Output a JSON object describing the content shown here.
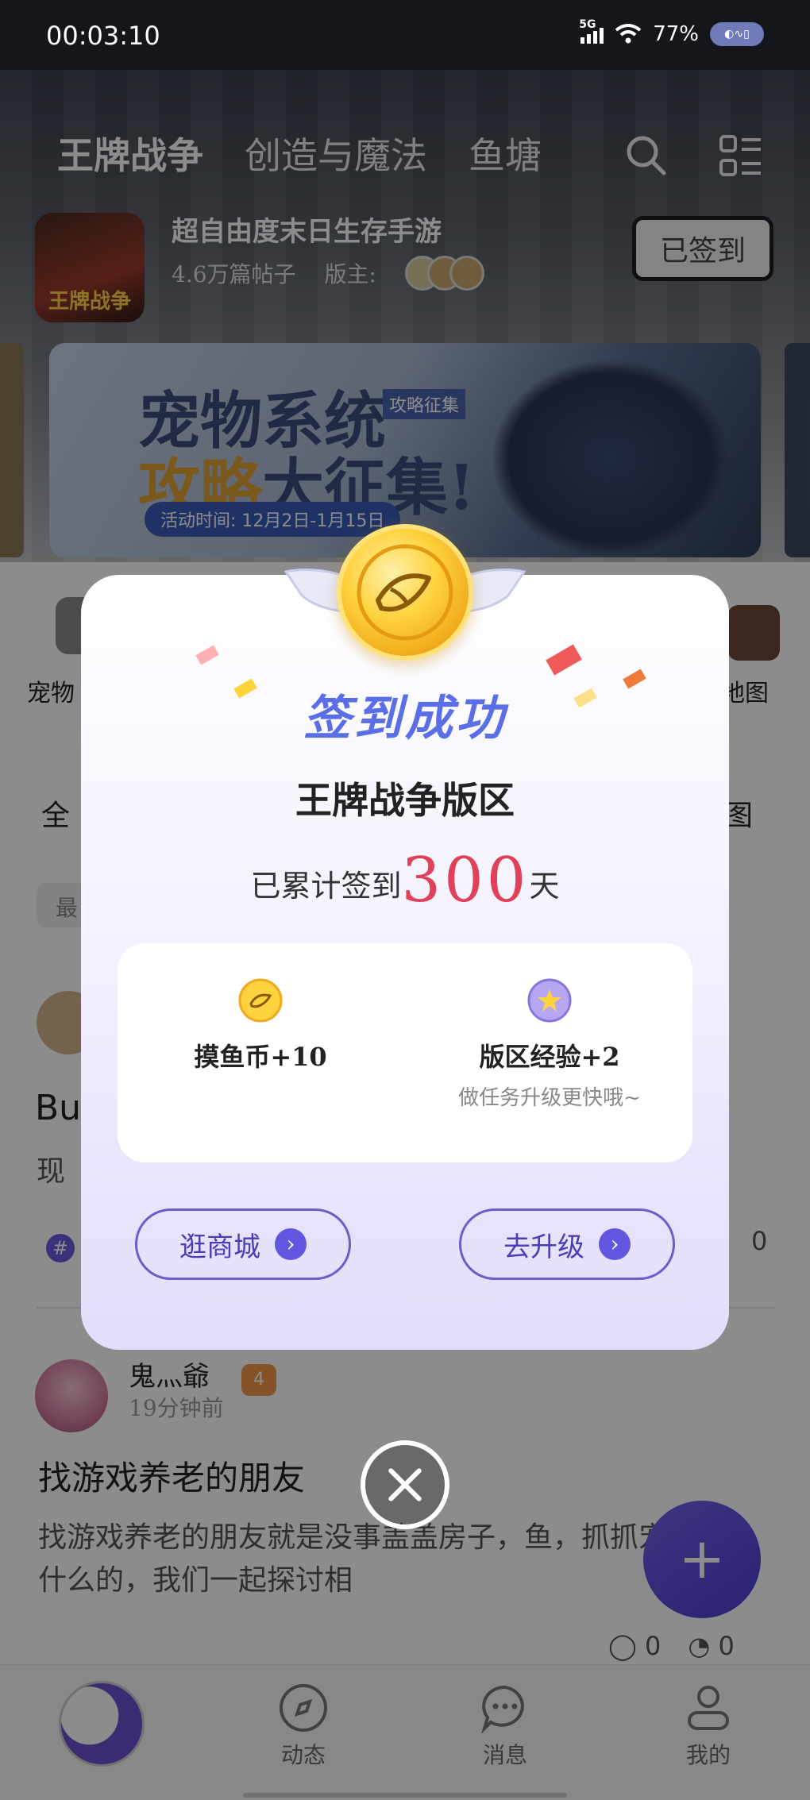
{
  "status_bar": {
    "time": "00:03:10",
    "network": "5G",
    "battery": "77%"
  },
  "header": {
    "tabs": [
      "王牌战争",
      "创造与魔法",
      "鱼塘"
    ],
    "active_tab": "王牌战争",
    "icons": [
      "search-icon",
      "menu-grid-icon"
    ]
  },
  "forum": {
    "name": "超自由度末日生存手游",
    "posts_count": "4.6万篇帖子",
    "moderators_label": "版主:",
    "signed_button": "已签到",
    "logo_text": "王牌战争"
  },
  "banner": {
    "line1": "宠物系统",
    "line2a": "攻略",
    "line2b": "大征集!",
    "tag": "攻略征集",
    "time": "活动时间: 12月2日-1月15日"
  },
  "quick_links": {
    "left": "宠物",
    "right": "地图"
  },
  "filter": {
    "left": "全",
    "right": "图",
    "chip": "最"
  },
  "post1": {
    "title": "Bu",
    "body": "现",
    "topic_icon": "#",
    "likes": "0"
  },
  "post2": {
    "author": "鬼灬爺",
    "level": "4",
    "time": "19分钟前",
    "title": "找游戏养老的朋友",
    "body": "找游戏养老的朋友就是没事盖盖房子，鱼，抓抓宠物什么的，我们一起探讨相",
    "comments": "0",
    "likes": "0"
  },
  "fab": {
    "label": "+"
  },
  "bottom_nav": {
    "items": [
      "动态",
      "消息",
      "我的"
    ]
  },
  "modal": {
    "title": "签到成功",
    "forum_title": "王牌战争版区",
    "streak_prefix": "已累计签到",
    "streak_days": "300",
    "streak_suffix": "天",
    "rewards": [
      {
        "label": "摸鱼币+10",
        "sub": "",
        "icon": "fish-coin-icon"
      },
      {
        "label": "版区经验+2",
        "sub": "做任务升级更快哦~",
        "icon": "star-badge-icon"
      }
    ],
    "buttons": [
      {
        "label": "逛商城",
        "arrow": "›"
      },
      {
        "label": "去升级",
        "arrow": "›"
      }
    ],
    "close_icon": "close-icon"
  },
  "colors": {
    "accent": "#6256e0",
    "title_blue": "#5a6ee8",
    "streak_red": "#e04058",
    "coin_gold": "#ffd23f"
  }
}
